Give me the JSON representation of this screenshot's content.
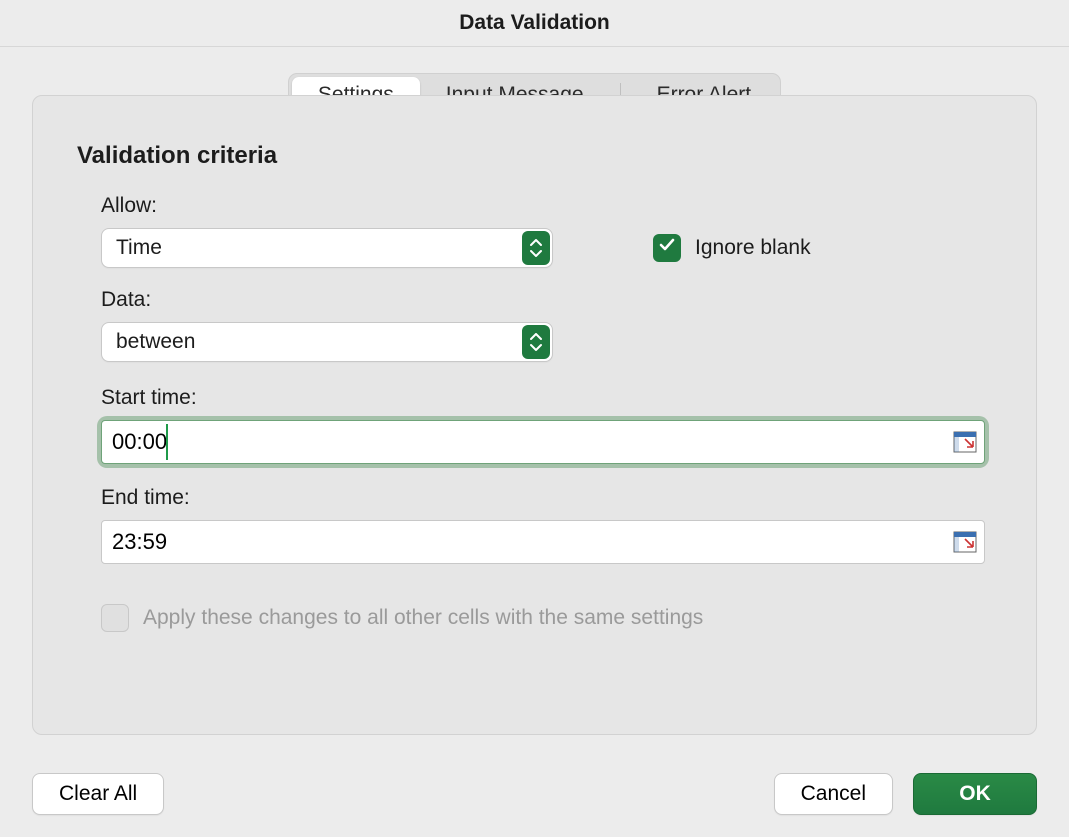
{
  "title": "Data Validation",
  "tabs": {
    "settings": "Settings",
    "input_message": "Input Message",
    "error_alert": "Error Alert"
  },
  "section_heading": "Validation criteria",
  "labels": {
    "allow": "Allow:",
    "data": "Data:",
    "start_time": "Start time:",
    "end_time": "End time:",
    "ignore_blank": "Ignore blank",
    "apply_changes": "Apply these changes to all other cells with the same settings"
  },
  "values": {
    "allow": "Time",
    "data": "between",
    "start_time": "00:00",
    "end_time": "23:59",
    "ignore_blank_checked": true,
    "apply_changes_checked": false,
    "apply_changes_enabled": false
  },
  "buttons": {
    "clear_all": "Clear All",
    "cancel": "Cancel",
    "ok": "OK"
  },
  "icons": {
    "stepper": "chevron-up-down-icon",
    "checkmark": "checkmark-icon",
    "cell_reference": "cell-reference-icon"
  },
  "colors": {
    "accent_green": "#1f7a3f",
    "focus_ring": "#6fa379"
  }
}
